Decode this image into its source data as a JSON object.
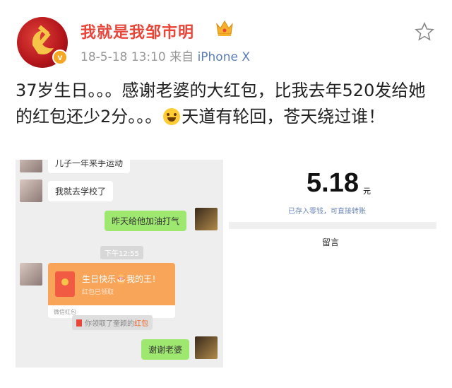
{
  "post": {
    "username": "我就是我邹市明",
    "date": "18-5-18 13:10",
    "source_prefix": "来自",
    "device": "iPhone X",
    "verified_badge": "v",
    "text_part1": "37岁生日。。。感谢老婆的大红包，比我去年520发给她的红包还少2分。。。",
    "emoji_name": "laughing-tears",
    "text_part2": "天道有轮回，苍天绕过谁！"
  },
  "chat_image": {
    "msg_top_partial": "儿子一年来手运动",
    "msg_1": "我就去学校了",
    "msg_2": "昨天给他加油打气",
    "time": "下午12:55",
    "redpacket_title": "生日快乐🎂我的王！",
    "redpacket_sub": "红包已领取",
    "redpacket_footer": "微信红包",
    "notice_prefix": "你领取了奎颖的",
    "notice_highlight": "红包",
    "msg_3": "谢谢老婆"
  },
  "amount_image": {
    "amount": "5.18",
    "unit": "元",
    "note": "已存入零钱，可直接转账",
    "remark": "留言"
  },
  "colors": {
    "username": "#e8463a",
    "device": "#5b7fb4",
    "chat_bubble_me": "#9ee870",
    "redpacket": "#f8a55a"
  }
}
